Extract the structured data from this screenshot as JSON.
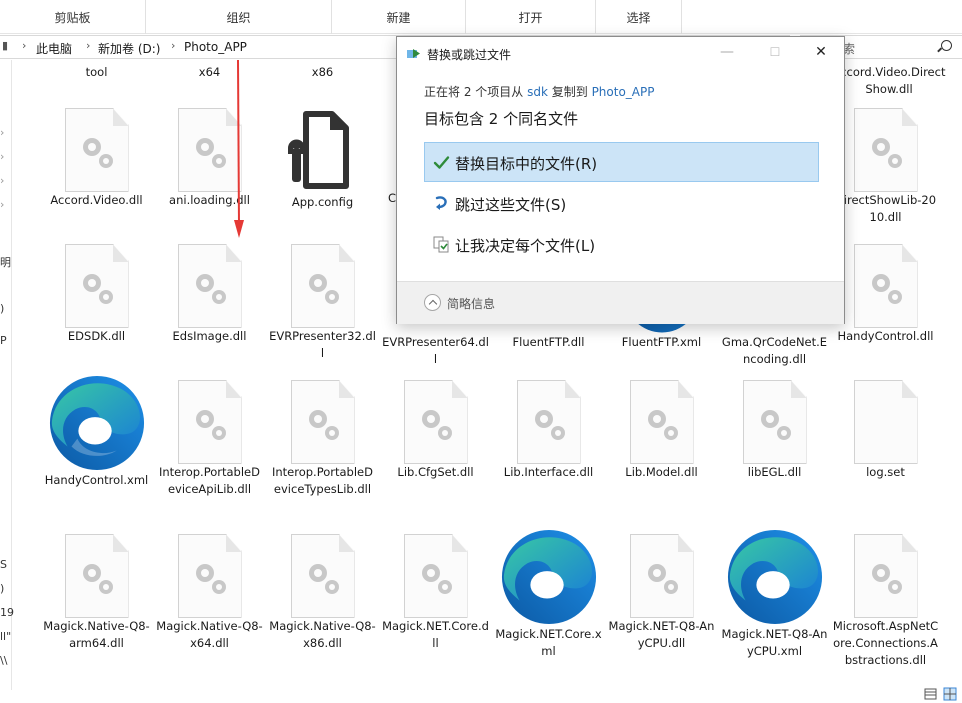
{
  "ribbon": {
    "groups": [
      "剪贴板",
      "组织",
      "新建",
      "打开",
      "选择"
    ]
  },
  "address": {
    "crumbs": [
      "此电脑",
      "新加卷 (D:)",
      "Photo_APP"
    ],
    "search_text": "索"
  },
  "nav": {
    "fragments": [
      "明",
      "P",
      ")",
      "S",
      ")",
      "19",
      "ll\"",
      "\\\\"
    ]
  },
  "files": {
    "row0_labels": [
      "tool",
      "x64",
      "x86",
      "Accord.Video.DirectShow.dll"
    ],
    "row1": [
      "Accord.Video.dll",
      "ani.loading.dll",
      "App.config",
      "C",
      "DirectShowLib-2010.dll"
    ],
    "row2": [
      "EDSDK.dll",
      "EdsImage.dll",
      "EVRPresenter32.dll",
      "EVRPresenter64.dll",
      "FluentFTP.dll",
      "FluentFTP.xml",
      "Gma.QrCodeNet.Encoding.dll",
      "HandyControl.dll"
    ],
    "row3": [
      "HandyControl.xml",
      "Interop.PortableDeviceApiLib.dll",
      "Interop.PortableDeviceTypesLib.dll",
      "Lib.CfgSet.dll",
      "Lib.Interface.dll",
      "Lib.Model.dll",
      "libEGL.dll",
      "log.set"
    ],
    "row4": [
      "Magick.Native-Q8-arm64.dll",
      "Magick.Native-Q8-x64.dll",
      "Magick.Native-Q8-x86.dll",
      "Magick.NET.Core.dll",
      "Magick.NET.Core.xml",
      "Magick.NET-Q8-AnyCPU.dll",
      "Magick.NET-Q8-AnyCPU.xml",
      "Microsoft.AspNetCore.Connections.Abstractions.dll"
    ]
  },
  "dialog": {
    "title": "替换或跳过文件",
    "minimize": "—",
    "maximize": "☐",
    "close": "✕",
    "line1_prefix": "正在将 2 个项目从 ",
    "line1_src": "sdk",
    "line1_mid": " 复制到 ",
    "line1_dst": "Photo_APP",
    "line2": "目标包含 2 个同名文件",
    "opt_replace": "替换目标中的文件(R)",
    "opt_skip": "跳过这些文件(S)",
    "opt_decide": "让我决定每个文件(L)",
    "more_info": "简略信息"
  },
  "colors": {
    "selection": "#cce4f7",
    "selection_border": "#99c9ef",
    "link": "#2a6fb8",
    "arrow": "#e53935",
    "check": "#2e8b3a"
  }
}
